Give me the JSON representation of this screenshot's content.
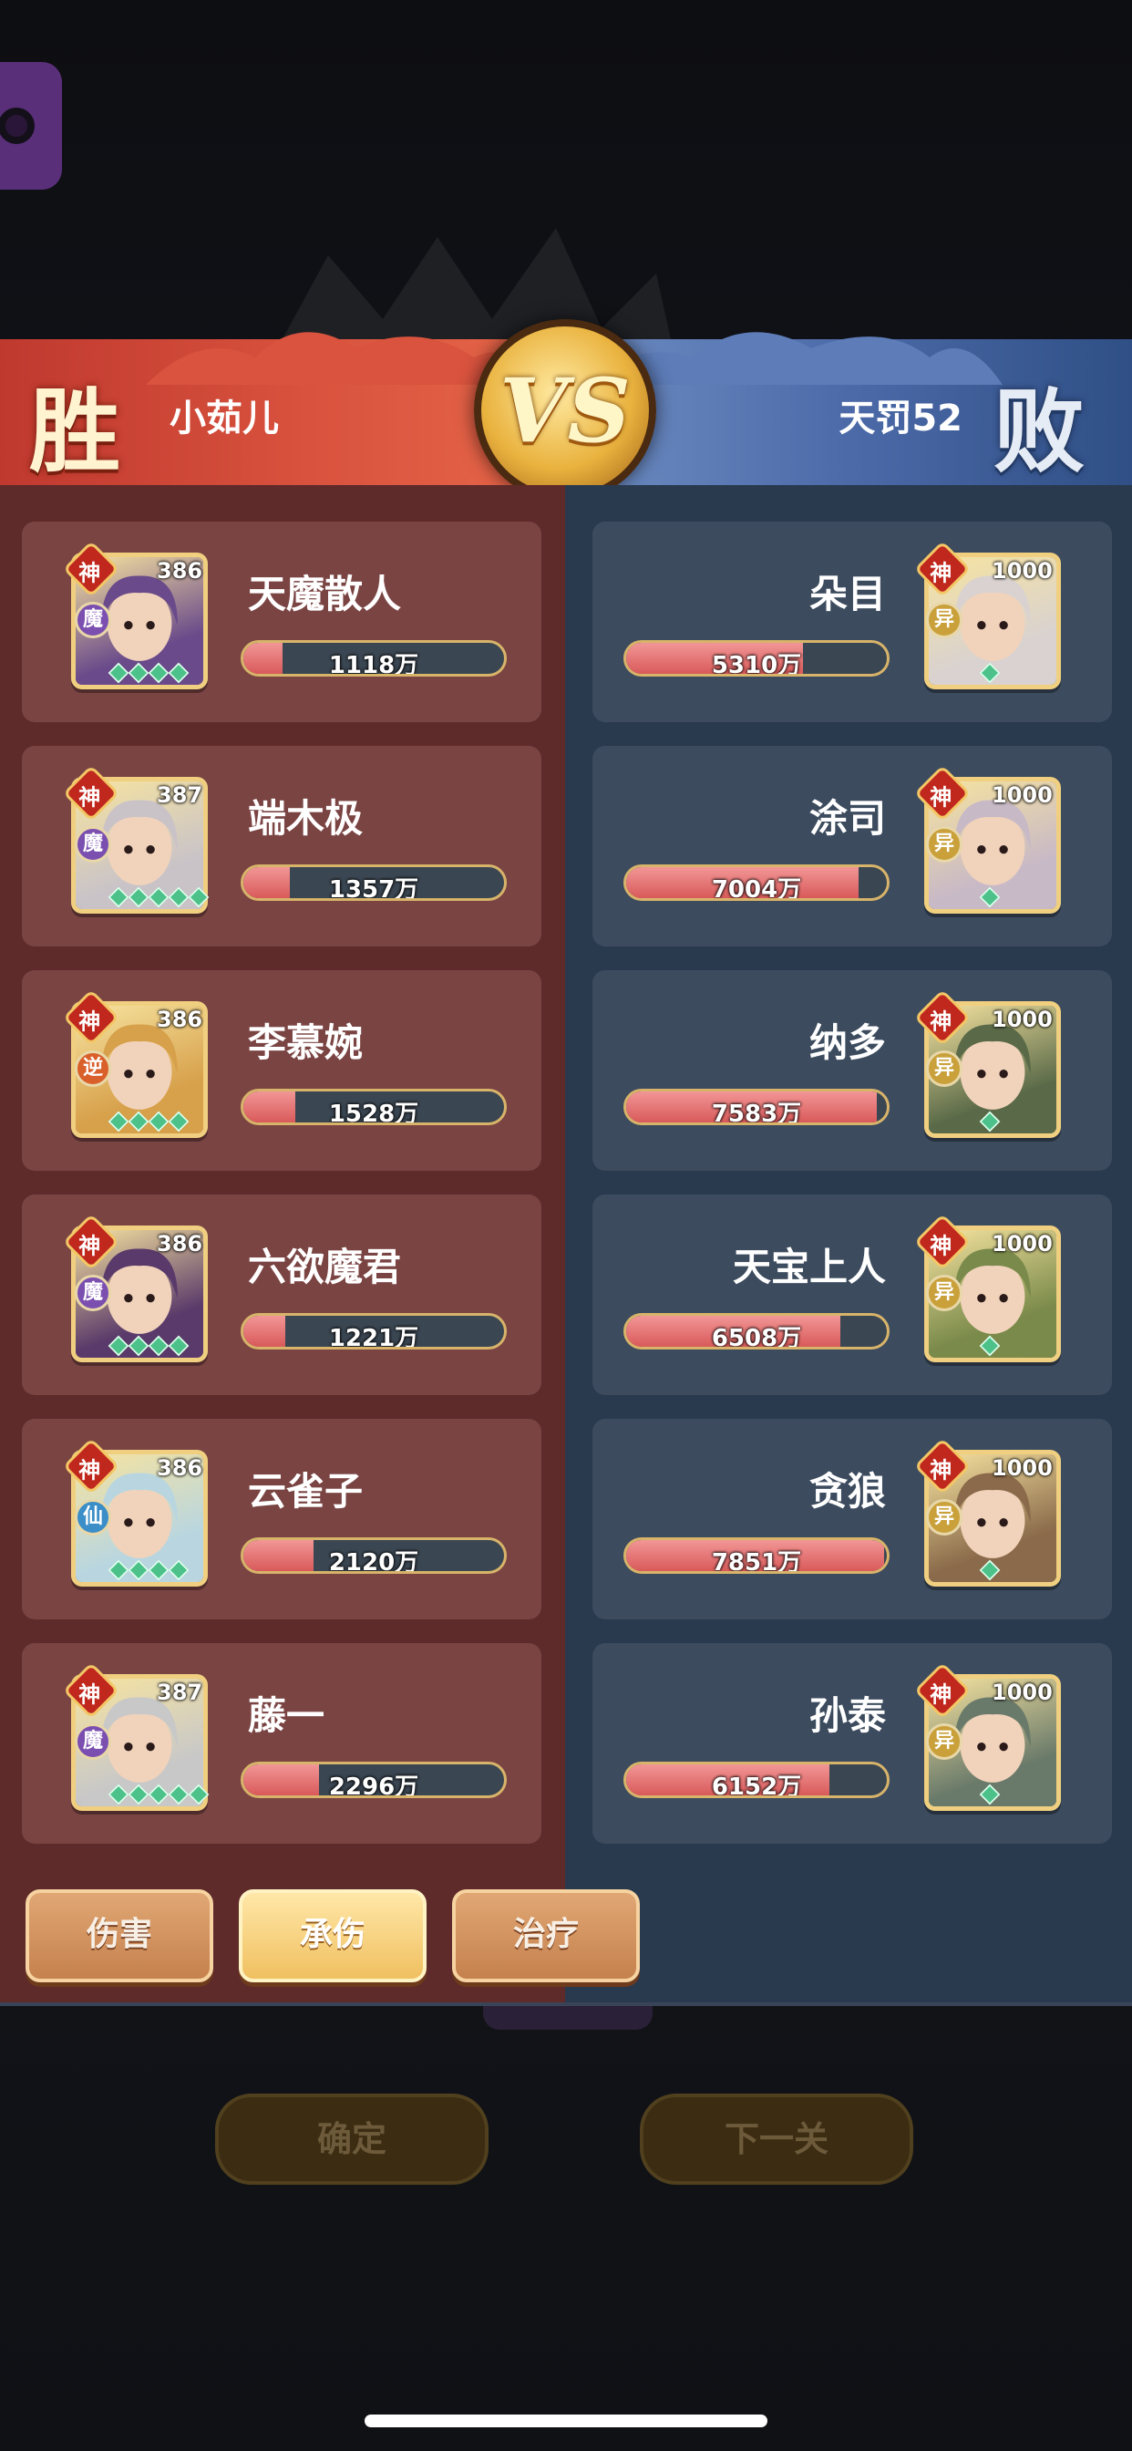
{
  "battle": {
    "left": {
      "result": "胜",
      "player_name": "小茹儿",
      "color": "#c0392f"
    },
    "right": {
      "result": "败",
      "player_name": "天罚52",
      "color": "#4c6aa8"
    },
    "vs_label": "VS"
  },
  "left_heroes": [
    {
      "name": "天魔散人",
      "level": "386",
      "rank_badge": "神",
      "type_badge": "魔",
      "type_color": "#7b4fb0",
      "stat": "1118万",
      "fill": 0.15,
      "stars": 4
    },
    {
      "name": "端木极",
      "level": "387",
      "rank_badge": "神",
      "type_badge": "魔",
      "type_color": "#7b4fb0",
      "stat": "1357万",
      "fill": 0.18,
      "stars": 5
    },
    {
      "name": "李慕婉",
      "level": "386",
      "rank_badge": "神",
      "type_badge": "逆",
      "type_color": "#d9602a",
      "stat": "1528万",
      "fill": 0.2,
      "stars": 4
    },
    {
      "name": "六欲魔君",
      "level": "386",
      "rank_badge": "神",
      "type_badge": "魔",
      "type_color": "#7b4fb0",
      "stat": "1221万",
      "fill": 0.16,
      "stars": 4
    },
    {
      "name": "云雀子",
      "level": "386",
      "rank_badge": "神",
      "type_badge": "仙",
      "type_color": "#3b8ec7",
      "stat": "2120万",
      "fill": 0.27,
      "stars": 4
    },
    {
      "name": "藤一",
      "level": "387",
      "rank_badge": "神",
      "type_badge": "魔",
      "type_color": "#7b4fb0",
      "stat": "2296万",
      "fill": 0.29,
      "stars": 5
    }
  ],
  "right_heroes": [
    {
      "name": "朵目",
      "level": "1000",
      "rank_badge": "神",
      "type_badge": "异",
      "type_color": "#c9a03a",
      "stat": "5310万",
      "fill": 0.68,
      "stars": 1
    },
    {
      "name": "涂司",
      "level": "1000",
      "rank_badge": "神",
      "type_badge": "异",
      "type_color": "#c9a03a",
      "stat": "7004万",
      "fill": 0.89,
      "stars": 1
    },
    {
      "name": "纳多",
      "level": "1000",
      "rank_badge": "神",
      "type_badge": "异",
      "type_color": "#c9a03a",
      "stat": "7583万",
      "fill": 0.96,
      "stars": 1
    },
    {
      "name": "天宝上人",
      "level": "1000",
      "rank_badge": "神",
      "type_badge": "异",
      "type_color": "#c9a03a",
      "stat": "6508万",
      "fill": 0.82,
      "stars": 1
    },
    {
      "name": "贪狼",
      "level": "1000",
      "rank_badge": "神",
      "type_badge": "异",
      "type_color": "#c9a03a",
      "stat": "7851万",
      "fill": 0.99,
      "stars": 1
    },
    {
      "name": "孙泰",
      "level": "1000",
      "rank_badge": "神",
      "type_badge": "异",
      "type_color": "#c9a03a",
      "stat": "6152万",
      "fill": 0.78,
      "stars": 1
    }
  ],
  "tabs": [
    {
      "label": "伤害",
      "active": false
    },
    {
      "label": "承伤",
      "active": true
    },
    {
      "label": "治疗",
      "active": false
    }
  ],
  "background_buttons": {
    "confirm": "确定",
    "next": "下一关"
  },
  "portrait_palettes": {
    "left": [
      "#6a4a8a",
      "#c9c3c8",
      "#d7a04a",
      "#5a3a6a",
      "#b9d6e0",
      "#c8c8c8"
    ],
    "right": [
      "#d9d2d0",
      "#c8b9c6",
      "#5a6a48",
      "#7a8a4a",
      "#8a6a4a",
      "#6a7a6a"
    ]
  }
}
